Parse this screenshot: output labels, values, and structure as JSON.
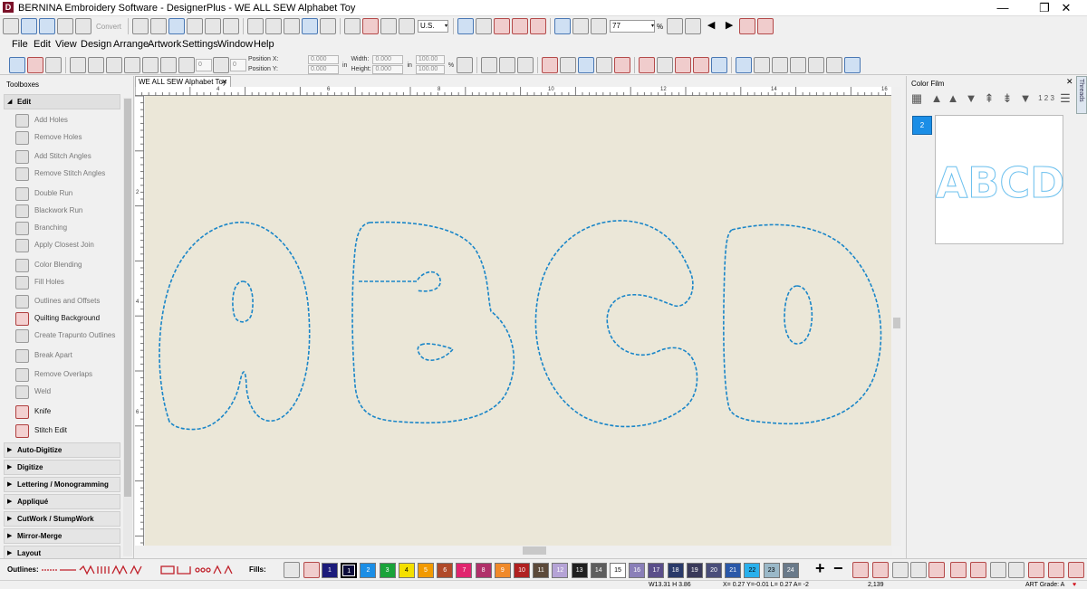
{
  "window": {
    "title": "BERNINA Embroidery Software - DesignerPlus - WE ALL SEW Alphabet Toy",
    "app_icon_letter": "D",
    "minimize": "—",
    "maximize": "❐",
    "close": "✕"
  },
  "toolbar_top": {
    "convert_label": "Convert",
    "units": "U.S.",
    "zoom_value": "77",
    "zoom_unit": "%"
  },
  "menu": [
    "File",
    "Edit",
    "View",
    "Design",
    "Arrange",
    "Artwork",
    "Settings",
    "Window",
    "Help"
  ],
  "props": {
    "angle_value": "0",
    "width_value": "0",
    "position_x_label": "Position X:",
    "position_y_label": "Position Y:",
    "position_x": "0.000",
    "position_y": "0.000",
    "width_label": "Width:",
    "height_label": "Height:",
    "width": "0.000",
    "height": "0.000",
    "scale_x": "100.00",
    "scale_y": "100.00",
    "unit_in": "in",
    "unit_pct": "%"
  },
  "left_panel": {
    "title": "Toolboxes",
    "edit_header": "Edit",
    "items": [
      {
        "label": "Add Holes",
        "active": false
      },
      {
        "label": "Remove Holes",
        "active": false
      },
      {
        "label": "Add Stitch Angles",
        "active": false
      },
      {
        "label": "Remove Stitch Angles",
        "active": false
      },
      {
        "label": "Double Run",
        "active": false
      },
      {
        "label": "Blackwork Run",
        "active": false
      },
      {
        "label": "Branching",
        "active": false
      },
      {
        "label": "Apply Closest Join",
        "active": false
      },
      {
        "label": "Color Blending",
        "active": false
      },
      {
        "label": "Fill Holes",
        "active": false
      },
      {
        "label": "Outlines and Offsets",
        "active": false
      },
      {
        "label": "Quilting Background",
        "active": true
      },
      {
        "label": "Create Trapunto Outlines",
        "active": false
      },
      {
        "label": "Break Apart",
        "active": false
      },
      {
        "label": "Remove Overlaps",
        "active": false
      },
      {
        "label": "Weld",
        "active": false
      },
      {
        "label": "Knife",
        "active": true
      },
      {
        "label": "Stitch Edit",
        "active": true
      }
    ],
    "sections": [
      "Auto-Digitize",
      "Digitize",
      "Lettering / Monogramming",
      "Appliqué",
      "CutWork / StumpWork",
      "Mirror-Merge",
      "Layout"
    ]
  },
  "document": {
    "tab_label": "WE ALL SEW Alphabet Toy",
    "tab_close": "✕",
    "ruler_top": [
      "4",
      "6",
      "8",
      "10",
      "12",
      "14",
      "16"
    ],
    "ruler_left": [
      "2",
      "4",
      "6"
    ],
    "design_text": "ABCD"
  },
  "color_film": {
    "title": "Color Film",
    "close": "✕",
    "threads_tab": "Threads",
    "order_label": "1 2 3",
    "swatch_number": "2",
    "swatch_color": "#1b8ee6",
    "stitch_color": "#1a86c8"
  },
  "bottom_toolbar": {
    "outlines_label": "Outlines:",
    "fills_label": "Fills:",
    "selected_chip": "1",
    "colors": [
      {
        "num": "1",
        "color": "#1b1b7a"
      },
      {
        "num": "1",
        "color": "#0b0b3a"
      },
      {
        "num": "2",
        "color": "#1b8ee6"
      },
      {
        "num": "3",
        "color": "#1aa33a"
      },
      {
        "num": "4",
        "color": "#f4e000"
      },
      {
        "num": "5",
        "color": "#f29a00"
      },
      {
        "num": "6",
        "color": "#b04a2a"
      },
      {
        "num": "7",
        "color": "#e0246e"
      },
      {
        "num": "8",
        "color": "#b0306a"
      },
      {
        "num": "9",
        "color": "#f08a2a"
      },
      {
        "num": "10",
        "color": "#b02020"
      },
      {
        "num": "11",
        "color": "#5c4a3a"
      },
      {
        "num": "12",
        "color": "#b5a3d6"
      },
      {
        "num": "13",
        "color": "#202020"
      },
      {
        "num": "14",
        "color": "#5e5e5e"
      },
      {
        "num": "15",
        "color": "#ffffff"
      },
      {
        "num": "16",
        "color": "#8a7fb8"
      },
      {
        "num": "17",
        "color": "#5a4e8a"
      },
      {
        "num": "18",
        "color": "#2a3a6a"
      },
      {
        "num": "19",
        "color": "#3a3a5a"
      },
      {
        "num": "20",
        "color": "#4a4e7a"
      },
      {
        "num": "21",
        "color": "#2a58a8"
      },
      {
        "num": "22",
        "color": "#2ab0ec"
      },
      {
        "num": "23",
        "color": "#9ab8c8"
      },
      {
        "num": "24",
        "color": "#6a7a8a"
      }
    ]
  },
  "status": {
    "dims": "W13.31 H 3.86",
    "coords": "X= 0.27 Y=-0.01 L= 0.27 A= -2",
    "value": "2,139",
    "art_grade": "ART Grade: A",
    "heart": "♥"
  }
}
